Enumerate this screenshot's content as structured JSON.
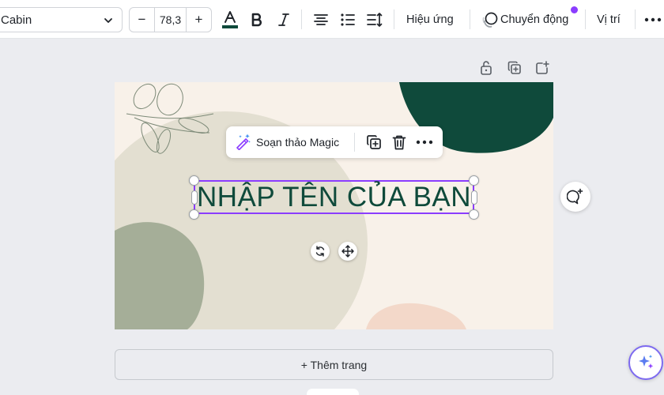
{
  "toolbar": {
    "font_name": "Cabin",
    "font_size": "78,3",
    "decrease_label": "−",
    "increase_label": "+",
    "effects_label": "Hiệu ứng",
    "animate_label": "Chuyển động",
    "position_label": "Vị trí",
    "text_color": "#0f4a3b",
    "icons": [
      "chevron-down-icon",
      "text-color-icon",
      "bold-icon",
      "italic-icon",
      "align-center-icon",
      "list-icon",
      "spacing-icon",
      "animate-icon",
      "more-icon"
    ]
  },
  "page_tools": {
    "icons": [
      "lock-icon",
      "duplicate-page-icon",
      "add-page-icon"
    ]
  },
  "context_menu": {
    "magic_label": "Soạn thảo Magic",
    "icons": [
      "magic-write-icon",
      "duplicate-icon",
      "trash-icon",
      "more-icon"
    ]
  },
  "design": {
    "heading": "NHẬP TÊN CỦA BẠN",
    "colors": {
      "background": "#f8f1e9",
      "dark_green": "#0f4a3b",
      "sage": "#a5ae98",
      "beige": "#e3dfd1",
      "peach": "#f3d8c9",
      "text": "#0f4a3b",
      "selection": "#8b3dff"
    }
  },
  "canvas_controls": {
    "icons": [
      "rotate-icon",
      "move-icon",
      "comment-icon"
    ]
  },
  "add_page_label": "+ Thêm trang",
  "accent_color": "#8b3dff"
}
